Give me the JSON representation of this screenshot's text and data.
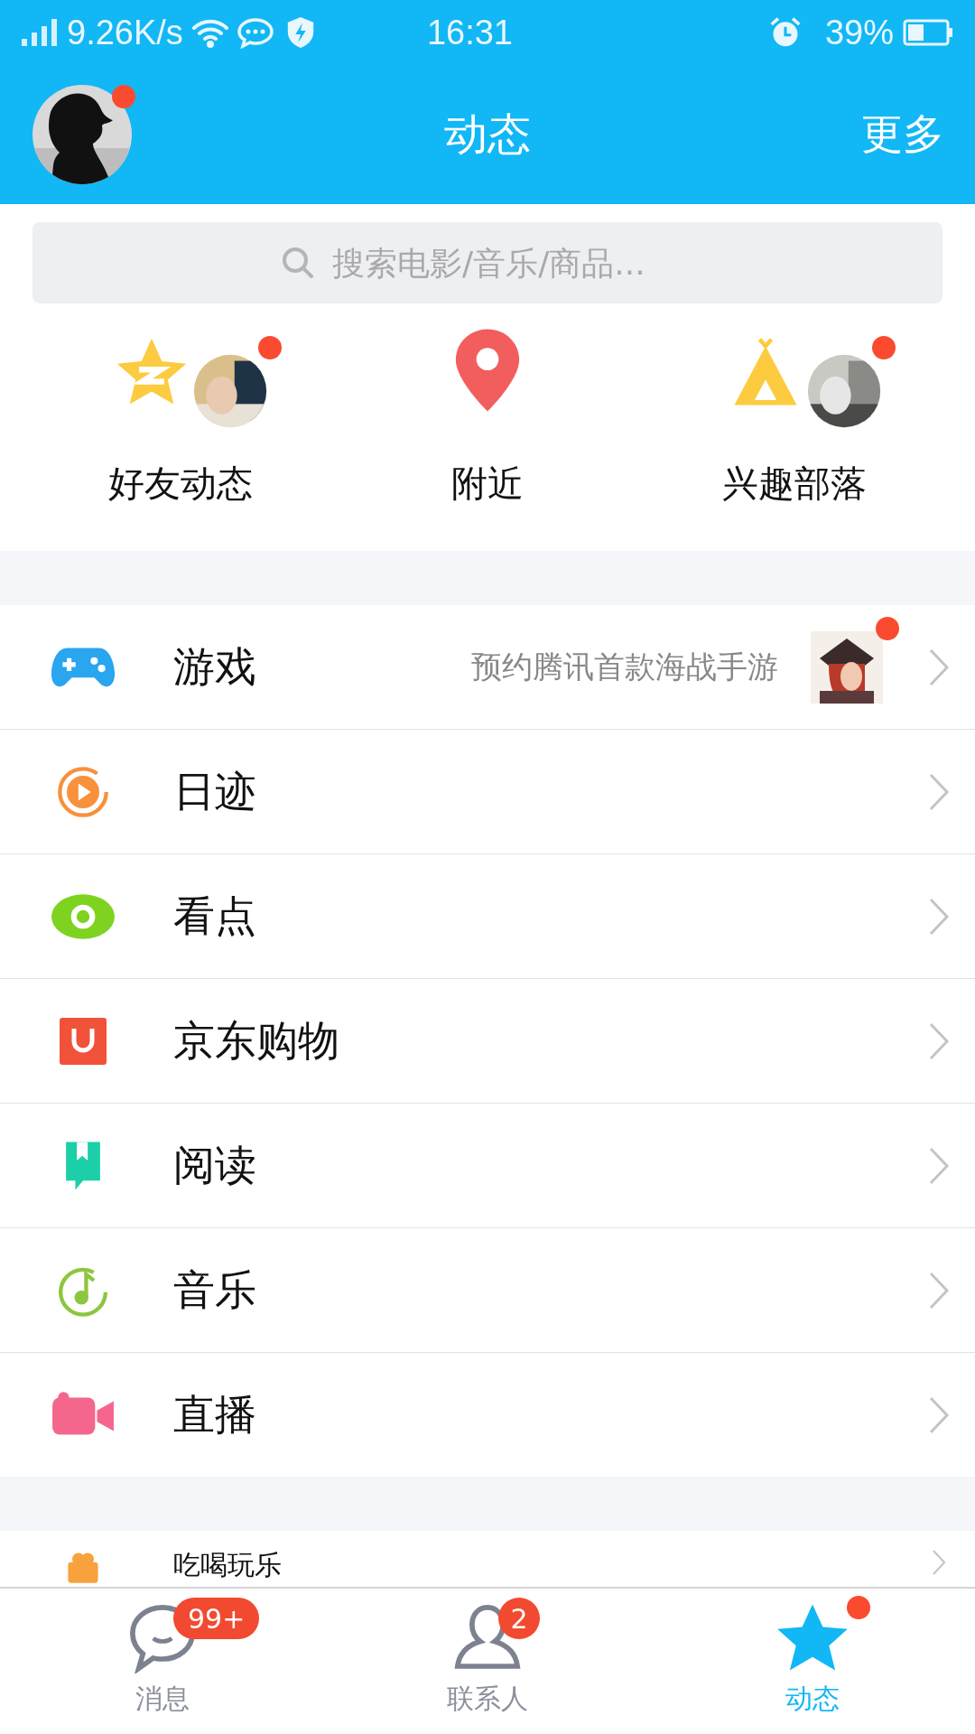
{
  "status_bar": {
    "speed": "9.26K/s",
    "time": "16:31",
    "battery": "39%"
  },
  "header": {
    "title": "动态",
    "action": "更多",
    "avatar_unread": true
  },
  "search": {
    "placeholder": "搜索电影/音乐/商品..."
  },
  "shortcuts": [
    {
      "kind": "friends",
      "label": "好友动态",
      "unread": true
    },
    {
      "kind": "nearby",
      "label": "附近",
      "unread": false
    },
    {
      "kind": "tribe",
      "label": "兴趣部落",
      "unread": true
    }
  ],
  "menu": [
    {
      "kind": "game",
      "label": "游戏",
      "subtitle": "预约腾讯首款海战手游",
      "unread": true
    },
    {
      "kind": "moments",
      "label": "日迹",
      "unread": false
    },
    {
      "kind": "watch",
      "label": "看点",
      "unread": false
    },
    {
      "kind": "shop",
      "label": "京东购物",
      "unread": false
    },
    {
      "kind": "read",
      "label": "阅读",
      "unread": false
    },
    {
      "kind": "music",
      "label": "音乐",
      "unread": false
    },
    {
      "kind": "live",
      "label": "直播",
      "unread": false
    }
  ],
  "partial_row": {
    "kind": "food",
    "label": "吃喝玩乐"
  },
  "tab_bar": [
    {
      "kind": "chat",
      "label": "消息",
      "selected": false,
      "badge": "99+",
      "dot": false
    },
    {
      "kind": "contacts",
      "label": "联系人",
      "selected": false,
      "badge": "2",
      "dot": false
    },
    {
      "kind": "star",
      "label": "动态",
      "selected": true,
      "dot": true
    }
  ]
}
